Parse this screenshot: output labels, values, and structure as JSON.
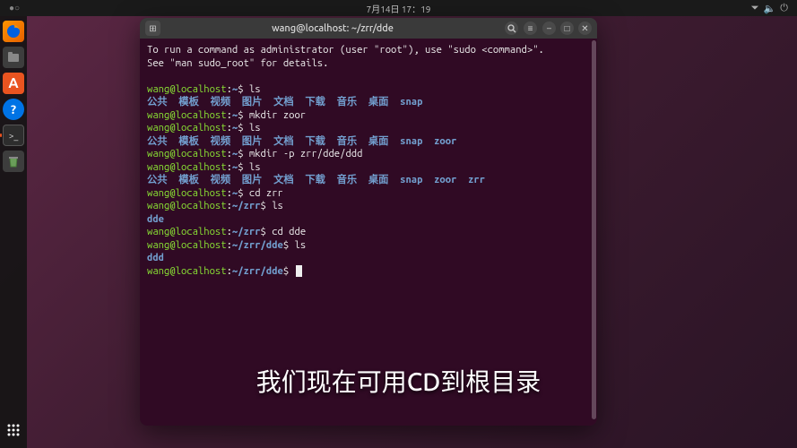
{
  "top_panel": {
    "date": "7月14日 17：19",
    "network_icon": "⏻",
    "volume_icon": "🔊",
    "power_icon": "⏻"
  },
  "dock": {
    "firefox": "🦊",
    "files": "📁",
    "store": "A",
    "help": "?",
    "terminal": ">_",
    "trash": "♻",
    "apps": "⠿"
  },
  "terminal": {
    "title": "wang@localhost: ~/zrr/dde",
    "tab_icon": "⊞",
    "search_icon": "⚲",
    "menu_icon": "≡",
    "min_icon": "–",
    "max_icon": "□",
    "close_icon": "✕",
    "intro1": "To run a command as administrator (user \"root\"), use \"sudo <command>\".",
    "intro2": "See \"man sudo_root\" for details.",
    "prompt_user": "wang@localhost",
    "prompt_colon": ":",
    "prompt_tilde": "~",
    "prompt_dollar": "$ ",
    "path_zrr": "~/zrr",
    "path_dde": "~/zrr/dde",
    "cmd_ls": "ls",
    "cmd_mkdir_zoor": "mkdir zoor",
    "cmd_mkdir_p": "mkdir -p zrr/dde/ddd",
    "cmd_cd_zrr": "cd zrr",
    "cmd_cd_dde": "cd dde",
    "dirs": {
      "d1": "公共",
      "d2": "模板",
      "d3": "视频",
      "d4": "图片",
      "d5": "文档",
      "d6": "下载",
      "d7": "音乐",
      "d8": "桌面",
      "snap": "snap",
      "zoor": "zoor",
      "zrr": "zrr",
      "dde": "dde",
      "ddd": "ddd"
    }
  },
  "subtitle": "我们现在可用CD到根目录"
}
